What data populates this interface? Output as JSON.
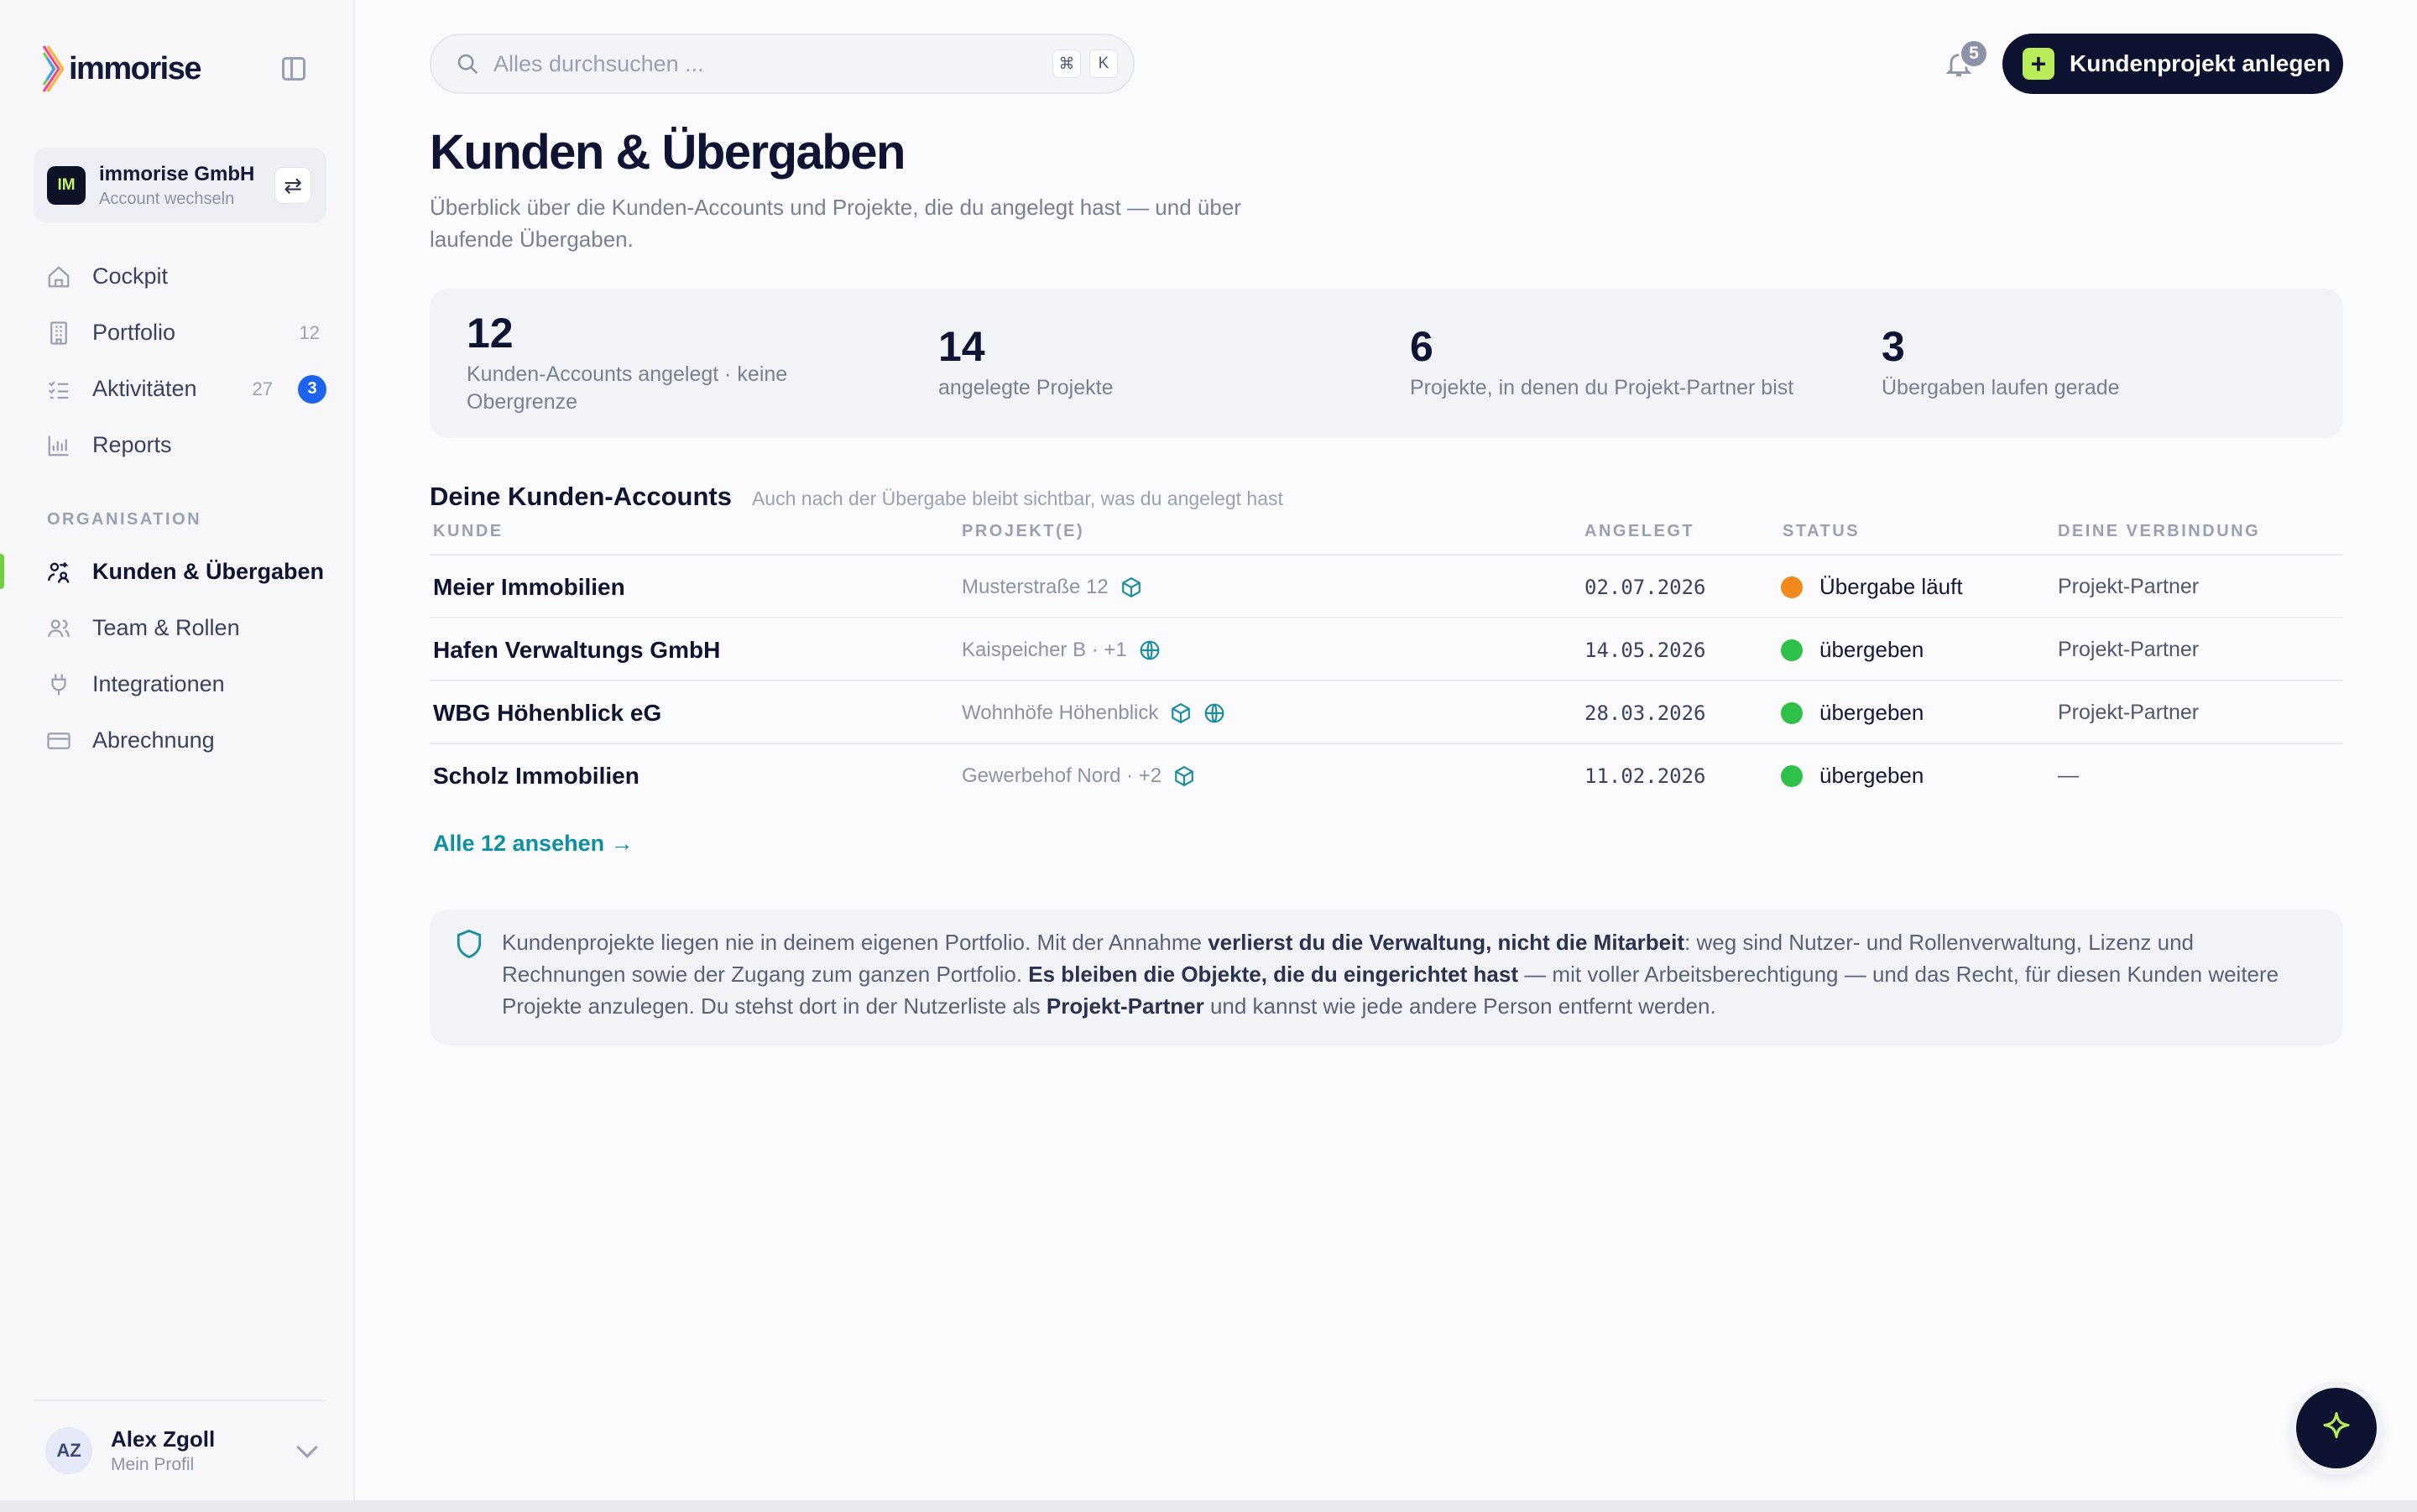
{
  "brand": {
    "name": "immorise"
  },
  "account": {
    "initials": "IM",
    "name": "immorise GmbH",
    "switch_label": "Account wechseln"
  },
  "nav": {
    "items": [
      {
        "label": "Cockpit",
        "icon": "home-icon"
      },
      {
        "label": "Portfolio",
        "icon": "building-icon",
        "count": "12"
      },
      {
        "label": "Aktivitäten",
        "icon": "checklist-icon",
        "count": "27",
        "badge": "3"
      },
      {
        "label": "Reports",
        "icon": "bar-chart-icon"
      }
    ],
    "org_section_label": "ORGANISATION",
    "org_items": [
      {
        "label": "Kunden & Übergaben",
        "icon": "handshake-icon",
        "active": true
      },
      {
        "label": "Team & Rollen",
        "icon": "users-icon"
      },
      {
        "label": "Integrationen",
        "icon": "plug-icon"
      },
      {
        "label": "Abrechnung",
        "icon": "credit-card-icon"
      }
    ]
  },
  "profile": {
    "initials": "AZ",
    "name": "Alex Zgoll",
    "sub": "Mein Profil"
  },
  "search": {
    "placeholder": "Alles durchsuchen ...",
    "value": "",
    "kbd_cmd": "⌘",
    "kbd_key": "K"
  },
  "notifications": {
    "count": "5"
  },
  "cta": {
    "label": "Kundenprojekt anlegen"
  },
  "page": {
    "title": "Kunden & Übergaben",
    "subtitle": "Überblick über die Kunden-Accounts und Projekte, die du angelegt hast — und über laufende Übergaben."
  },
  "stats": [
    {
      "value": "12",
      "label": "Kunden-Accounts angelegt · keine Obergrenze"
    },
    {
      "value": "14",
      "label": "angelegte Projekte"
    },
    {
      "value": "6",
      "label": "Projekte, in denen du Projekt-Partner bist"
    },
    {
      "value": "3",
      "label": "Übergaben laufen gerade"
    }
  ],
  "table": {
    "title": "Deine Kunden-Accounts",
    "hint": "Auch nach der Übergabe bleibt sichtbar, was du angelegt hast",
    "headers": {
      "kunde": "KUNDE",
      "projekte": "PROJEKT(E)",
      "angelegt": "ANGELEGT",
      "status": "STATUS",
      "verbindung": "DEINE VERBINDUNG"
    },
    "rows": [
      {
        "kunde": "Meier Immobilien",
        "projekt": "Musterstraße 12",
        "icons": [
          "cube-icon"
        ],
        "angelegt": "02.07.2026",
        "status": "Übergabe läuft",
        "status_color": "#f08a1c",
        "verbindung": "Projekt-Partner"
      },
      {
        "kunde": "Hafen Verwaltungs GmbH",
        "projekt": "Kaispeicher B · +1",
        "icons": [
          "globe-icon"
        ],
        "angelegt": "14.05.2026",
        "status": "übergeben",
        "status_color": "#2fc04a",
        "verbindung": "Projekt-Partner"
      },
      {
        "kunde": "WBG Höhenblick eG",
        "projekt": "Wohnhöfe Höhenblick",
        "icons": [
          "cube-icon",
          "globe-icon"
        ],
        "angelegt": "28.03.2026",
        "status": "übergeben",
        "status_color": "#2fc04a",
        "verbindung": "Projekt-Partner"
      },
      {
        "kunde": "Scholz Immobilien",
        "projekt": "Gewerbehof Nord · +2",
        "icons": [
          "cube-icon"
        ],
        "angelegt": "11.02.2026",
        "status": "übergeben",
        "status_color": "#2fc04a",
        "verbindung": "—"
      }
    ],
    "see_all": "Alle 12 ansehen →"
  },
  "info": {
    "t1": "Kundenprojekte liegen nie in deinem eigenen Portfolio. Mit der Annahme ",
    "b1": "verlierst du die Verwaltung, nicht die Mitarbeit",
    "t2": ": weg sind Nutzer- und Rollenverwaltung, Lizenz und Rechnungen sowie der Zugang zum ganzen Portfolio. ",
    "b2": "Es bleiben die Objekte, die du eingerichtet hast",
    "t3": " — mit voller Arbeitsberechtigung — und das Recht, für diesen Kunden weitere Projekte anzulegen. Du stehst dort in der Nutzerliste als ",
    "b3": "Projekt-Partner",
    "t4": " und kannst wie jede andere Person entfernt werden."
  },
  "colors": {
    "accent_green": "#b9ec59",
    "active_marker": "#6fd13f",
    "primary_dark": "#0d1230",
    "link": "#0e8fa3",
    "badge_blue": "#1e63f0"
  }
}
